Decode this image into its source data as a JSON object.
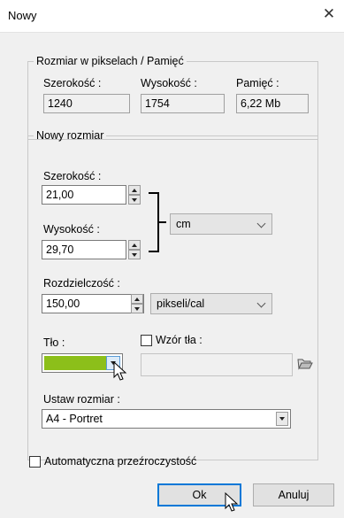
{
  "window": {
    "title": "Nowy",
    "close_glyph": "✕"
  },
  "pixel_group": {
    "legend": "Rozmiar w pikselach / Pamięć",
    "width_label": "Szerokość :",
    "width_value": "1240",
    "height_label": "Wysokość :",
    "height_value": "1754",
    "memory_label": "Pamięć :",
    "memory_value": "6,22 Mb"
  },
  "new_size_group": {
    "legend": "Nowy rozmiar",
    "width_label": "Szerokość :",
    "width_value": "21,00",
    "height_label": "Wysokość :",
    "height_value": "29,70",
    "unit_value": "cm",
    "resolution_label": "Rozdzielczość :",
    "resolution_value": "150,00",
    "resolution_unit": "pikseli/cal",
    "background_label": "Tło :",
    "background_color": "#8cbf1a",
    "pattern_label": "Wzór tła :",
    "pattern_checked": false,
    "preset_label": "Ustaw rozmiar :",
    "preset_value": "A4 - Portret"
  },
  "auto_transparency": {
    "label": "Automatyczna przeźroczystość",
    "checked": false
  },
  "buttons": {
    "ok": "Ok",
    "cancel": "Anuluj"
  },
  "icons": {
    "close": "close-icon",
    "spin": "spin-arrows-icon",
    "chevron": "chevron-down-icon",
    "folder": "open-folder-icon",
    "cursor": "mouse-pointer-icon"
  },
  "colors": {
    "accent": "#0078d7",
    "window_bg": "#f0f0f0"
  }
}
